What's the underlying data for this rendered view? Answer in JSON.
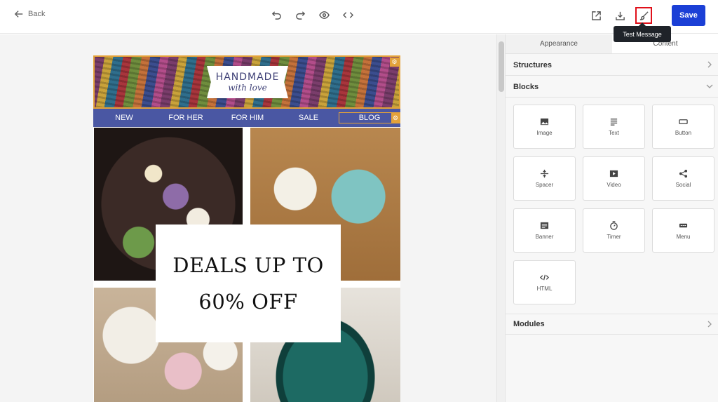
{
  "topbar": {
    "back_label": "Back",
    "save_label": "Save",
    "tooltip": "Test Message"
  },
  "email": {
    "logo_line1": "HANDMADE",
    "logo_line2": "with love",
    "nav": [
      "NEW",
      "FOR HER",
      "FOR HIM",
      "SALE",
      "BLOG"
    ],
    "deal_line1": "DEALS UP TO",
    "deal_line2": "60% OFF"
  },
  "panel": {
    "tabs": [
      "Appearance",
      "Content"
    ],
    "sections": {
      "structures": "Structures",
      "blocks": "Blocks",
      "modules": "Modules"
    },
    "blocks": [
      {
        "label": "Image",
        "icon": "image-icon"
      },
      {
        "label": "Text",
        "icon": "text-icon"
      },
      {
        "label": "Button",
        "icon": "button-icon"
      },
      {
        "label": "Spacer",
        "icon": "spacer-icon"
      },
      {
        "label": "Video",
        "icon": "video-icon"
      },
      {
        "label": "Social",
        "icon": "share-icon"
      },
      {
        "label": "Banner",
        "icon": "banner-icon"
      },
      {
        "label": "Timer",
        "icon": "timer-icon"
      },
      {
        "label": "Menu",
        "icon": "menu-icon"
      },
      {
        "label": "HTML",
        "icon": "code-icon"
      }
    ]
  },
  "colors": {
    "accent": "#1b3fd6",
    "nav_bg": "#4a57a3",
    "highlight": "#e0101a",
    "edit_tag": "#e3a23a"
  }
}
